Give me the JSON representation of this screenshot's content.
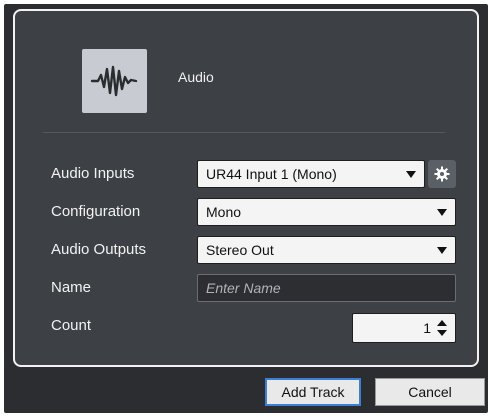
{
  "track_type": {
    "label": "Audio",
    "icon": "audio-waveform-icon"
  },
  "fields": {
    "audio_inputs": {
      "label": "Audio Inputs",
      "value": "UR44 Input 1 (Mono)"
    },
    "configuration": {
      "label": "Configuration",
      "value": "Mono"
    },
    "audio_outputs": {
      "label": "Audio Outputs",
      "value": "Stereo Out"
    },
    "name": {
      "label": "Name",
      "placeholder": "Enter Name",
      "value": ""
    },
    "count": {
      "label": "Count",
      "value": "1"
    }
  },
  "buttons": {
    "add_track": "Add Track",
    "cancel": "Cancel"
  },
  "icons": {
    "settings": "gear-icon",
    "dropdown": "chevron-down-icon",
    "stepper": "up-down-arrows-icon"
  }
}
